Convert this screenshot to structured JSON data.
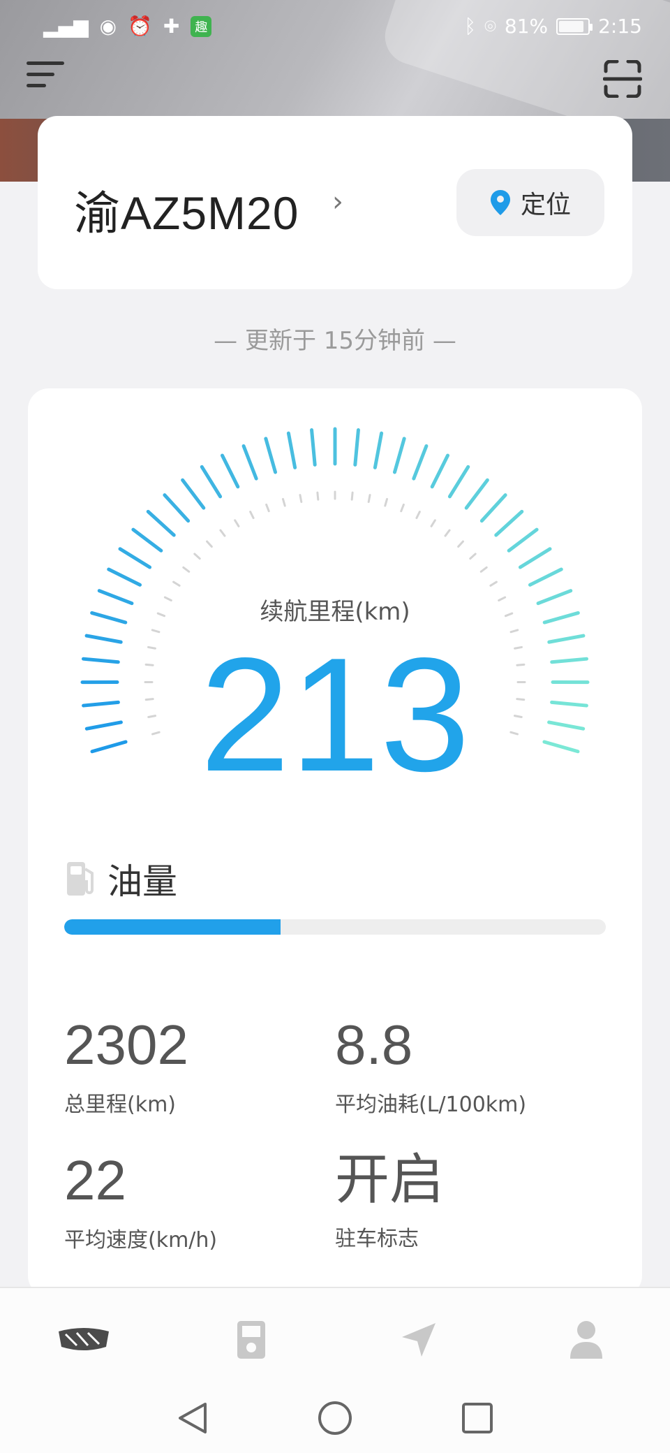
{
  "status_bar": {
    "battery": "81%",
    "time": "2:15"
  },
  "vehicle": {
    "plate": "渝AZ5M20",
    "locate_label": "定位"
  },
  "updated_text": "— 更新于 15分钟前 —",
  "gauge": {
    "label": "续航里程(km)",
    "value": "213"
  },
  "fuel": {
    "title": "油量",
    "level_fraction": 0.4
  },
  "stats": {
    "total_mileage": {
      "value": "2302",
      "label": "总里程(km)"
    },
    "avg_fuel": {
      "value": "8.8",
      "label": "平均油耗(L/100km)"
    },
    "avg_speed": {
      "value": "22",
      "label": "平均速度(km/h)"
    },
    "parking": {
      "value": "开启",
      "label": "驻车标志"
    }
  },
  "tabs": [
    {
      "icon": "car-brand-icon"
    },
    {
      "icon": "device-icon"
    },
    {
      "icon": "navigation-icon"
    },
    {
      "icon": "profile-icon"
    }
  ],
  "colors": {
    "accent": "#21a4ea",
    "gauge_start": "#1e9ae8",
    "gauge_end": "#7be8d6"
  }
}
